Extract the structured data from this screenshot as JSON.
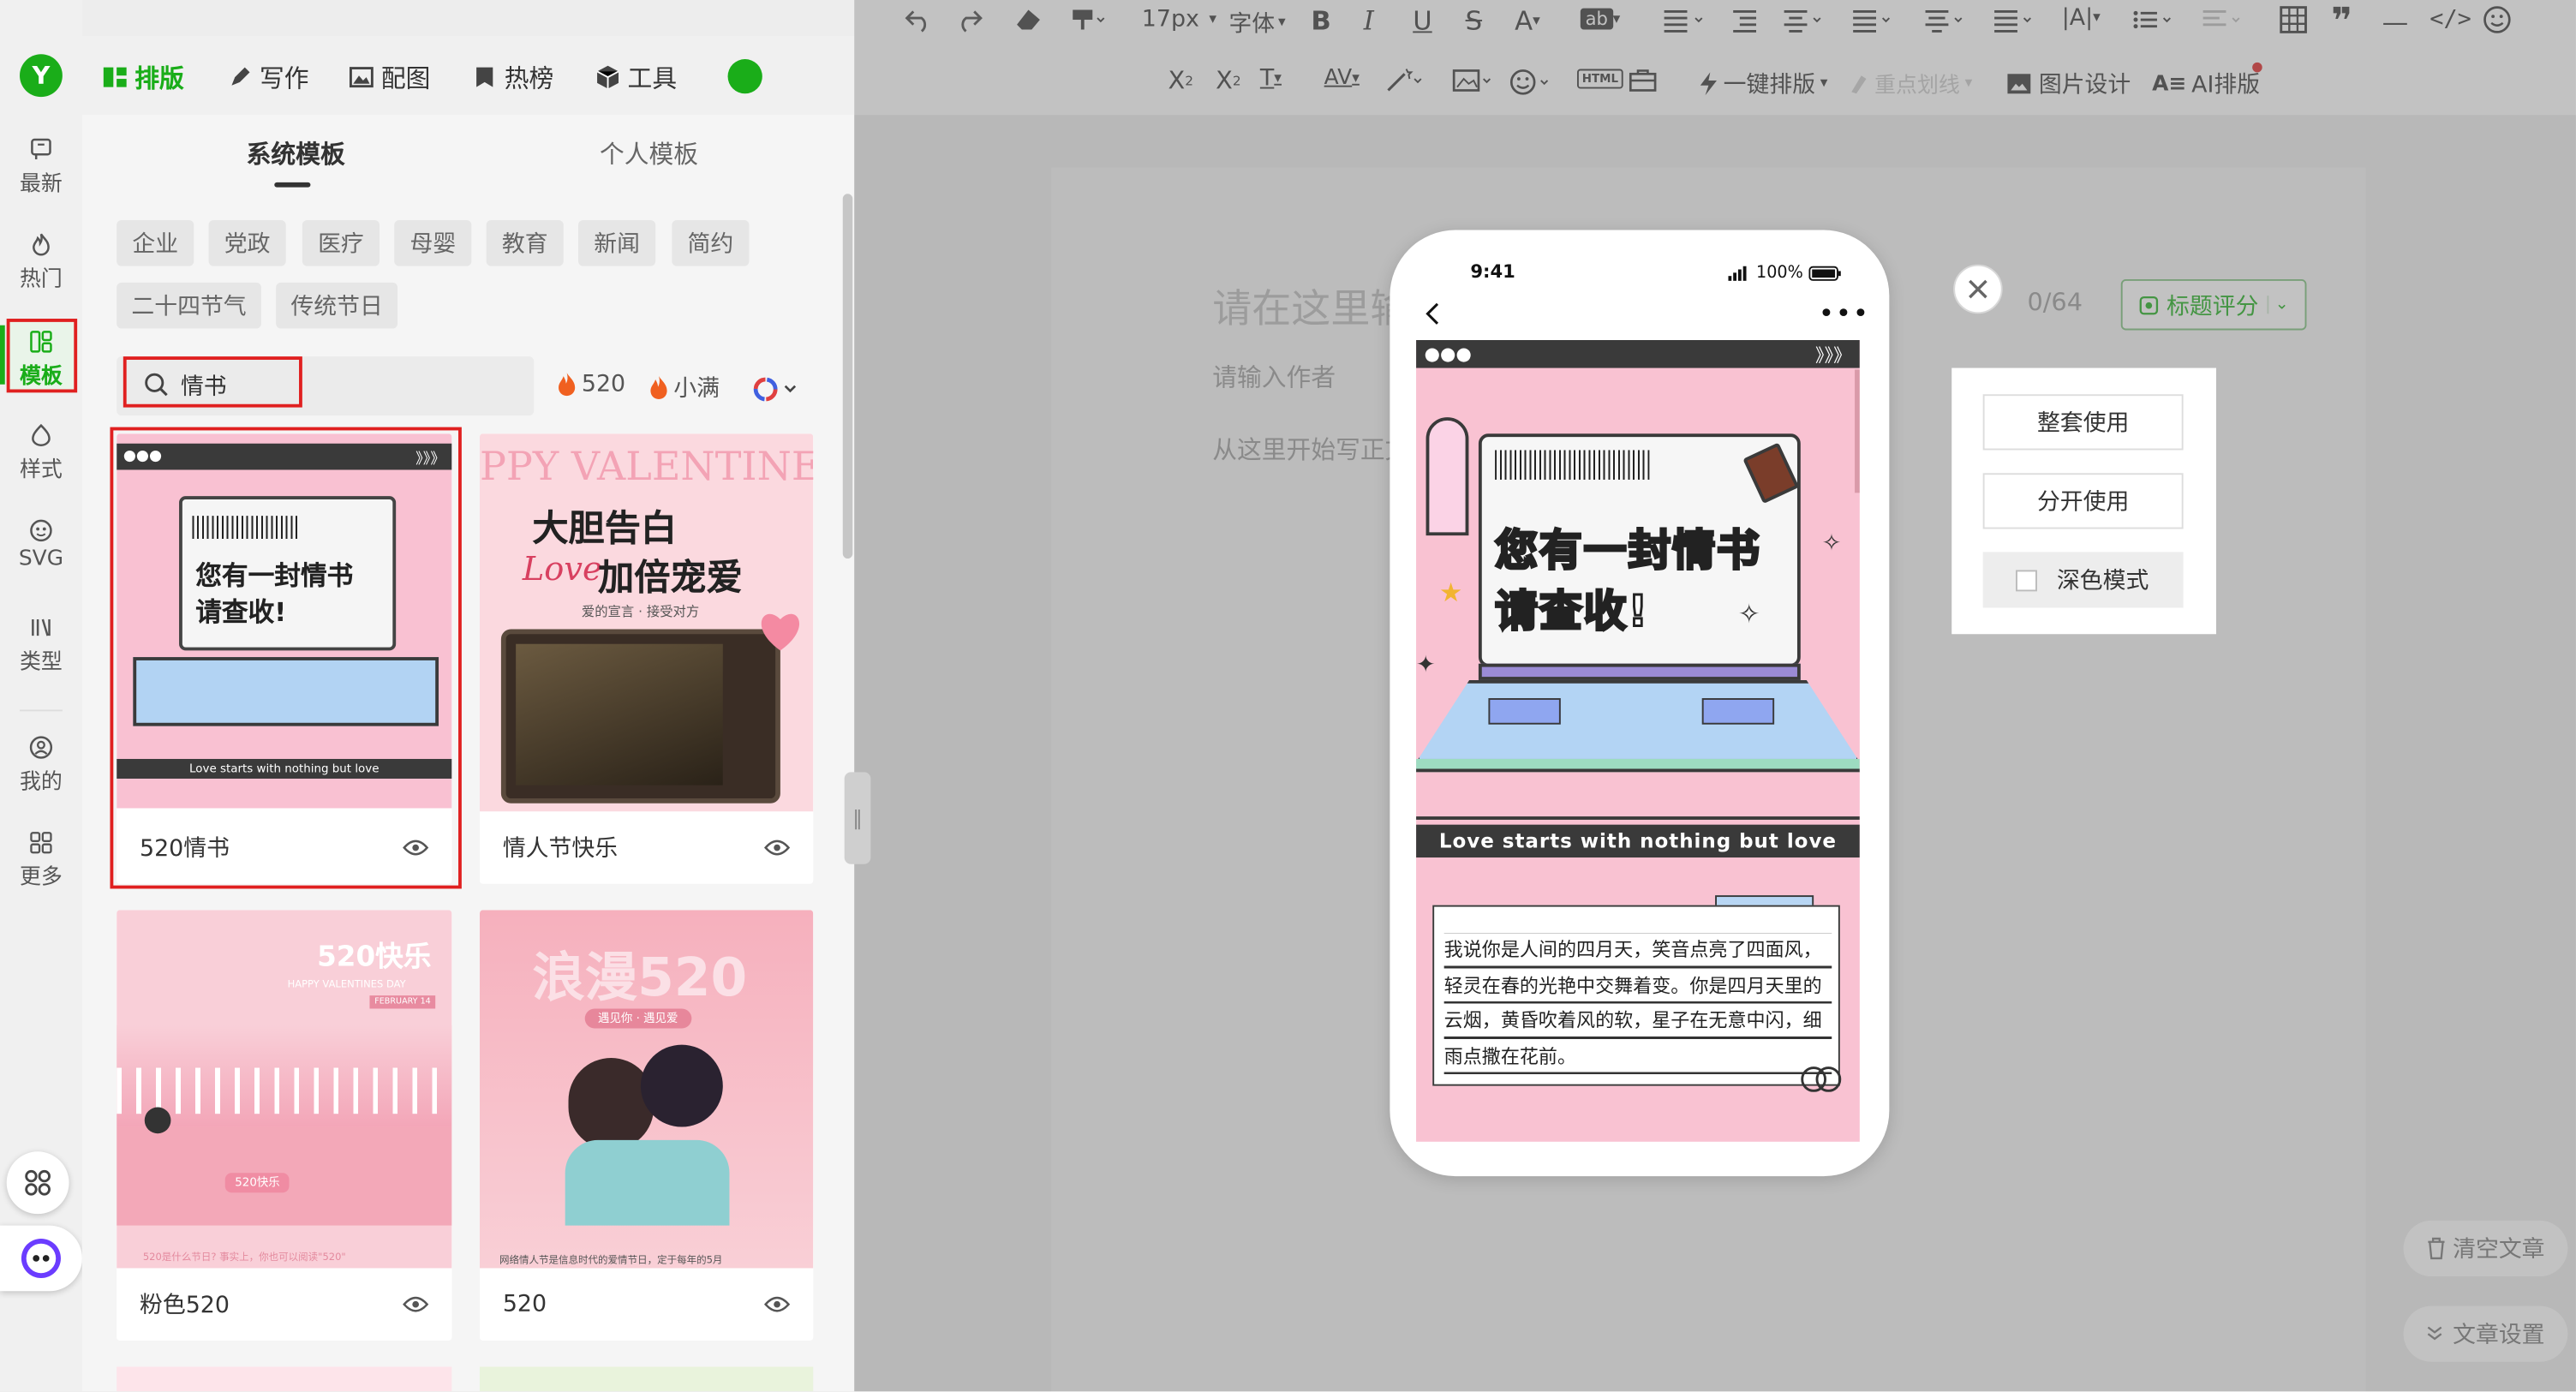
{
  "rail": {
    "logo": "Y",
    "items": [
      {
        "label": "最新",
        "icon": "flag-icon"
      },
      {
        "label": "热门",
        "icon": "flame-icon"
      },
      {
        "label": "模板",
        "icon": "template-icon"
      },
      {
        "label": "样式",
        "icon": "style-icon"
      },
      {
        "label": "SVG",
        "icon": "svg-icon"
      },
      {
        "label": "类型",
        "icon": "type-icon"
      },
      {
        "label": "我的",
        "icon": "user-icon"
      },
      {
        "label": "更多",
        "icon": "grid-icon"
      }
    ]
  },
  "topnav": [
    {
      "label": "排版",
      "icon": "layout-icon"
    },
    {
      "label": "写作",
      "icon": "pen-icon"
    },
    {
      "label": "配图",
      "icon": "image-icon"
    },
    {
      "label": "热榜",
      "icon": "bookmark-icon"
    },
    {
      "label": "工具",
      "icon": "cube-icon"
    }
  ],
  "panel": {
    "tabs": [
      "系统模板",
      "个人模板"
    ],
    "categories": [
      "企业",
      "党政",
      "医疗",
      "母婴",
      "教育",
      "新闻",
      "简约",
      "二十四节气",
      "传统节日"
    ],
    "search": {
      "value": "情书",
      "placeholder": ""
    },
    "hot_tags": [
      "520",
      "小满"
    ],
    "templates": [
      {
        "name": "520情书",
        "banner": "Love starts with nothing but love",
        "headline": [
          "您有一封情书",
          "请查收!"
        ]
      },
      {
        "name": "情人节快乐",
        "banner": "PPY VALENTINE",
        "headline": [
          "大胆告白",
          "加倍宠爱"
        ],
        "love": "Love",
        "sub": "爱的宣言 · 接受对方"
      },
      {
        "name": "粉色520",
        "banner": "520快乐",
        "sub": "HAPPY VALENTINES DAY",
        "badge": "FEBRUARY 14",
        "foot": "520是什么节日? 事实上，你也可以阅读\"520\"",
        "chip": "520快乐"
      },
      {
        "name": "520",
        "banner": "浪漫520",
        "sub": "遇见你 · 遇见爱",
        "foot": "网络情人节是信息时代的爱情节日，定于每年的5月"
      }
    ]
  },
  "toolbar": {
    "row1": {
      "font_size": "17px",
      "font": "字体"
    },
    "row2": {
      "one_click": "一键排版",
      "highlight": "重点划线",
      "image_design": "图片设计",
      "ai_layout": "AI排版"
    }
  },
  "editor": {
    "title_placeholder": "请在这里输入标题",
    "author_placeholder": "请输入作者",
    "body_placeholder": "从这里开始写正文",
    "counter": "0/64",
    "score_btn": "标题评分",
    "clear_btn": "清空文章",
    "settings_btn": "文章设置"
  },
  "preview": {
    "time": "9:41",
    "battery": "100%",
    "headline1": "您有一封情书",
    "headline2": "请查收!",
    "banner": "Love starts with nothing but love",
    "body": "我说你是人间的四月天，笑音点亮了四面风，轻灵在春的光艳中交舞着变。你是四月天里的云烟，黄昏吹着风的软，星子在无意中闪，细雨点撒在花前。"
  },
  "menu": {
    "use_all": "整套使用",
    "use_split": "分开使用",
    "dark_mode": "深色模式"
  },
  "colors": {
    "brand_green": "#1aad19",
    "highlight_red": "#e02020",
    "pink": "#f6b8c8",
    "dark": "#3a3a3a"
  }
}
